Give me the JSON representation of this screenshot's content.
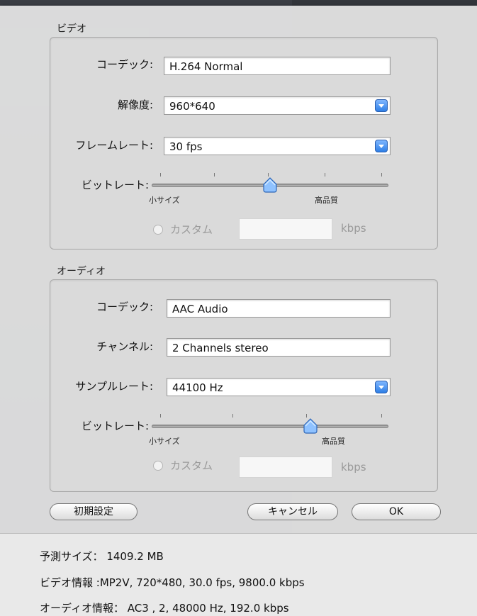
{
  "video": {
    "group_label": "ビデオ",
    "codec": {
      "label": "コーデック:",
      "value": "H.264 Normal"
    },
    "resolution": {
      "label": "解像度:",
      "value": "960*640"
    },
    "framerate": {
      "label": "フレームレート:",
      "value": "30 fps"
    },
    "bitrate": {
      "label": "ビットレート:",
      "min_label": "小サイズ",
      "max_label": "高品質",
      "level": 0.5
    },
    "custom": {
      "label": "カスタム",
      "value": "",
      "unit": "kbps"
    }
  },
  "audio": {
    "group_label": "オーディオ",
    "codec": {
      "label": "コーデック:",
      "value": "AAC Audio"
    },
    "channel": {
      "label": "チャンネル:",
      "value": "2 Channels stereo"
    },
    "samplerate": {
      "label": "サンプルレート:",
      "value": "44100 Hz"
    },
    "bitrate": {
      "label": "ビットレート:",
      "min_label": "小サイズ",
      "max_label": "高品質",
      "level": 0.67
    },
    "custom": {
      "label": "カスタム",
      "value": "",
      "unit": "kbps"
    }
  },
  "buttons": {
    "reset": "初期設定",
    "cancel": "キャンセル",
    "ok": "OK"
  },
  "info": {
    "estimated_size": "予測サイズ：  1409.2 MB",
    "video_info": "ビデオ情報 :MP2V, 720*480, 30.0 fps, 9800.0 kbps",
    "audio_info": "オーディオ情報：  AC3 , 2, 48000 Hz, 192.0 kbps"
  },
  "colors": {
    "accent": "#2f7fe6",
    "sheet": "#e4e4e4"
  }
}
